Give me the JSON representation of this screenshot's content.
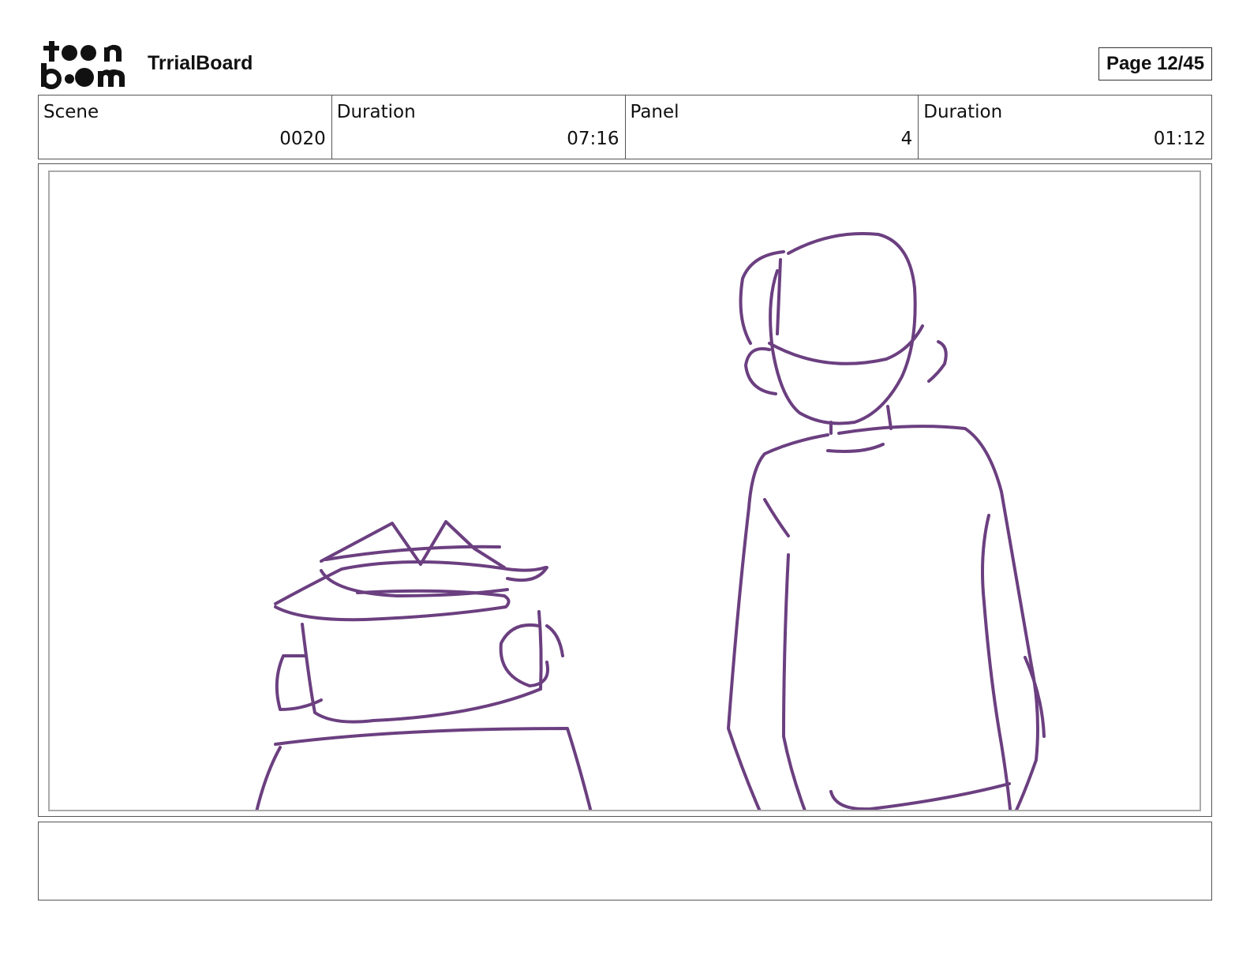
{
  "header": {
    "logo_text": "toon boom",
    "project_title": "TrrialBoard",
    "page_label": "Page 12/45"
  },
  "info": [
    {
      "label": "Scene",
      "value": "0020"
    },
    {
      "label": "Duration",
      "value": "07:16"
    },
    {
      "label": "Panel",
      "value": "4"
    },
    {
      "label": "Duration",
      "value": "01:12"
    }
  ],
  "panel": {
    "sketch_color": "#6b3f80"
  },
  "notes": {
    "text": ""
  }
}
